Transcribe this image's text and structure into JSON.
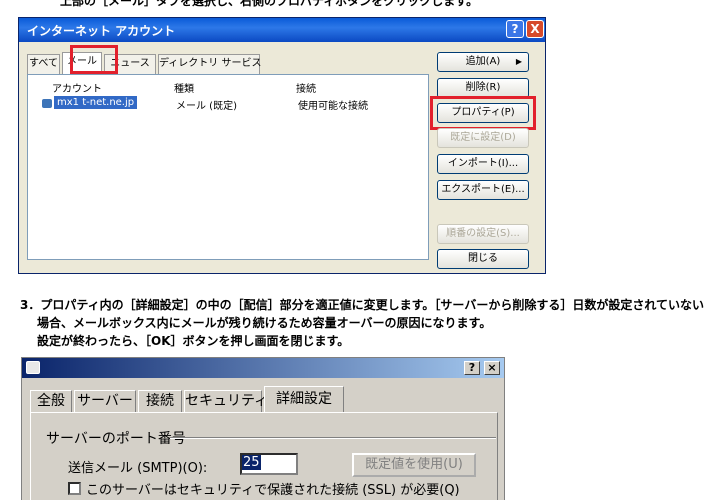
{
  "top_caption": "上部の［メール］タブを選択し、右側のプロパティボタンをクリックします。",
  "dialog1": {
    "title": "インターネット アカウント",
    "help_label": "?",
    "close_label": "X",
    "tabs": [
      "すべて",
      "メール",
      "ニュース",
      "ディレクトリ サービス"
    ],
    "columns": [
      "アカウント",
      "種類",
      "接続"
    ],
    "account": {
      "name": "mx1 t-net.ne.jp",
      "type": "メール (既定)",
      "connection": "使用可能な接続"
    },
    "buttons": {
      "add": "追加(A)",
      "add_arrow": "▶",
      "remove": "削除(R)",
      "properties": "プロパティ(P)",
      "set_default": "既定に設定(D)",
      "import": "インポート(I)...",
      "export": "エクスポート(E)...",
      "order": "順番の設定(S)...",
      "close": "閉じる"
    }
  },
  "step3": {
    "line1": "3．プロパティ内の［詳細設定］の中の［配信］部分を適正値に変更します。［サーバーから削除する］日数が設定されていない",
    "line2": "場合、メールボックス内にメールが残り続けるため容量オーバーの原因になります。",
    "line3": "設定が終わったら、［OK］ボタンを押し画面を閉じます。"
  },
  "dialog2": {
    "help_label": "?",
    "close_label": "×",
    "tabs": [
      "全般",
      "サーバー",
      "接続",
      "セキュリティ",
      "詳細設定"
    ],
    "group_label": "サーバーのポート番号",
    "smtp_label": "送信メール (SMTP)(O):",
    "smtp_value": "25",
    "default_button": "既定値を使用(U)",
    "ssl_label": "このサーバーはセキュリティで保護された接続 (SSL) が必要(Q)"
  }
}
